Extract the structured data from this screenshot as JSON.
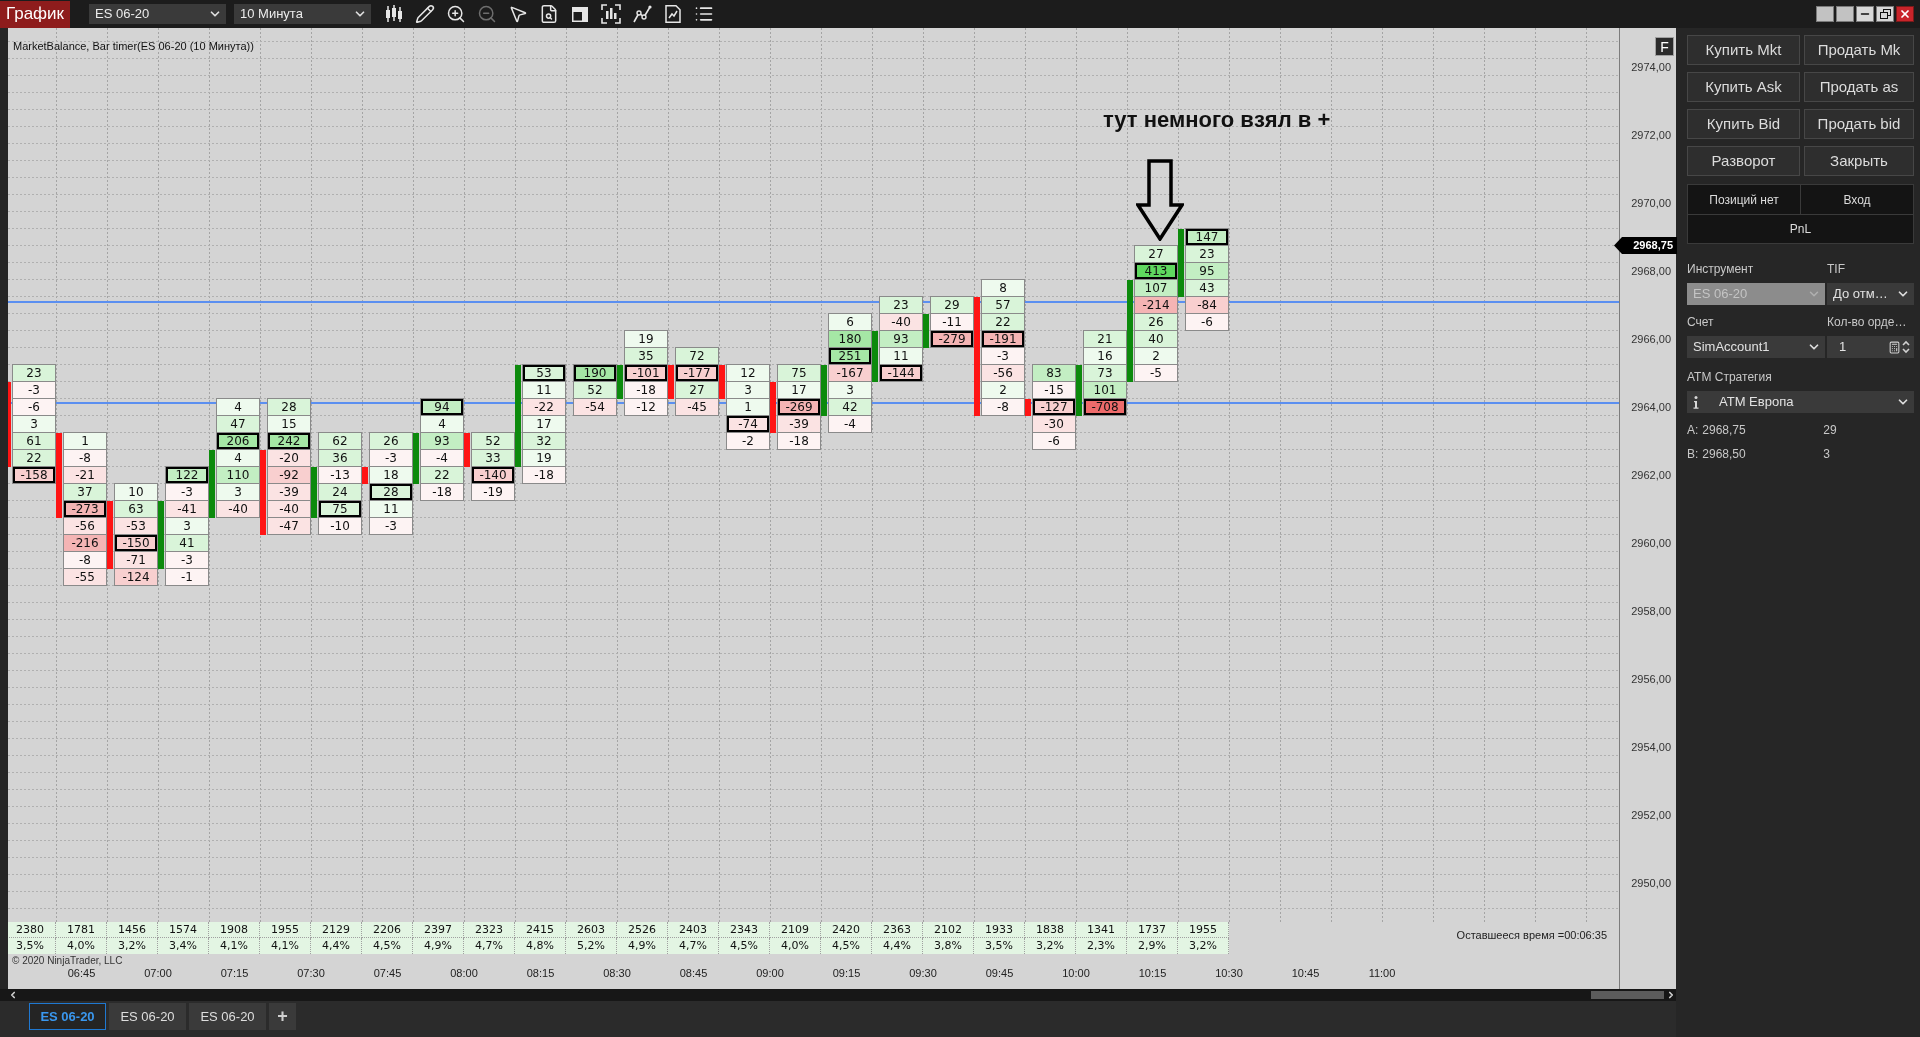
{
  "toolbar": {
    "title": "График",
    "instrument": "ES 06-20",
    "interval": "10 Минута"
  },
  "chart": {
    "title": "MarketBalance, Bar timer(ES 06-20 (10 Минута))",
    "corner_button": "F",
    "annotation": "тут немного взял в +",
    "price_axis": [
      "2974,00",
      "2972,00",
      "2970,00",
      "2968,00",
      "2966,00",
      "2964,00",
      "2962,00",
      "2960,00",
      "2958,00",
      "2956,00",
      "2954,00",
      "2952,00",
      "2950,00"
    ],
    "current_price": "2968,75",
    "bars": [
      {
        "color": "#ff1414",
        "cells": [
          {
            "text": "23",
            "color": "#d9f4d9",
            "boxed": false
          },
          {
            "text": "-3",
            "color": "#fdf3f3",
            "boxed": false
          },
          {
            "text": "-6",
            "color": "#fdf3f3",
            "boxed": false
          },
          {
            "text": "3",
            "color": "#eefaee",
            "boxed": false
          },
          {
            "text": "61",
            "color": "#d9f4d9",
            "boxed": false
          },
          {
            "text": "22",
            "color": "#d9f4d9",
            "boxed": false
          },
          {
            "text": "-158",
            "color": "#f8cfcf",
            "boxed": true
          }
        ]
      },
      {
        "color": "#ff1414",
        "cells": [
          {
            "text": "1",
            "color": "#eefaee",
            "boxed": false
          },
          {
            "text": "-8",
            "color": "#fdf3f3",
            "boxed": false
          },
          {
            "text": "-21",
            "color": "#fbe3e3",
            "boxed": false
          },
          {
            "text": "37",
            "color": "#d9f4d9",
            "boxed": false
          },
          {
            "text": "-273",
            "color": "#f4b4b4",
            "boxed": true
          },
          {
            "text": "-56",
            "color": "#fbe3e3",
            "boxed": false
          },
          {
            "text": "-216",
            "color": "#f4b4b4",
            "boxed": false
          },
          {
            "text": "-8",
            "color": "#fdf3f3",
            "boxed": false
          },
          {
            "text": "-55",
            "color": "#fbe3e3",
            "boxed": false
          }
        ]
      },
      {
        "color": "#ff1414",
        "cells": [
          {
            "text": "10",
            "color": "#eefaee",
            "boxed": false
          },
          {
            "text": "63",
            "color": "#d9f4d9",
            "boxed": false
          },
          {
            "text": "-53",
            "color": "#fbe3e3",
            "boxed": false
          },
          {
            "text": "-150",
            "color": "#f8cfcf",
            "boxed": true
          },
          {
            "text": "-71",
            "color": "#fbe3e3",
            "boxed": false
          },
          {
            "text": "-124",
            "color": "#f8cfcf",
            "boxed": false
          }
        ]
      },
      {
        "color": "#0c8a0c",
        "cells": [
          {
            "text": "122",
            "color": "#c3eec3",
            "boxed": true
          },
          {
            "text": "-3",
            "color": "#fdf3f3",
            "boxed": false
          },
          {
            "text": "-41",
            "color": "#fbe3e3",
            "boxed": false
          },
          {
            "text": "3",
            "color": "#eefaee",
            "boxed": false
          },
          {
            "text": "41",
            "color": "#d9f4d9",
            "boxed": false
          },
          {
            "text": "-3",
            "color": "#fdf3f3",
            "boxed": false
          },
          {
            "text": "-1",
            "color": "#fdf3f3",
            "boxed": false
          }
        ]
      },
      {
        "color": "#0c8a0c",
        "cells": [
          {
            "text": "4",
            "color": "#eefaee",
            "boxed": false
          },
          {
            "text": "47",
            "color": "#d9f4d9",
            "boxed": false
          },
          {
            "text": "206",
            "color": "#a5e7a5",
            "boxed": true
          },
          {
            "text": "4",
            "color": "#eefaee",
            "boxed": false
          },
          {
            "text": "110",
            "color": "#c3eec3",
            "boxed": false
          },
          {
            "text": "3",
            "color": "#eefaee",
            "boxed": false
          },
          {
            "text": "-40",
            "color": "#fbe3e3",
            "boxed": false
          }
        ]
      },
      {
        "color": "#ff1414",
        "cells": [
          {
            "text": "28",
            "color": "#d9f4d9",
            "boxed": false
          },
          {
            "text": "15",
            "color": "#eefaee",
            "boxed": false
          },
          {
            "text": "242",
            "color": "#a5e7a5",
            "boxed": true
          },
          {
            "text": "-20",
            "color": "#fbe3e3",
            "boxed": false
          },
          {
            "text": "-92",
            "color": "#f8cfcf",
            "boxed": false
          },
          {
            "text": "-39",
            "color": "#fbe3e3",
            "boxed": false
          },
          {
            "text": "-40",
            "color": "#fbe3e3",
            "boxed": false
          },
          {
            "text": "-47",
            "color": "#fbe3e3",
            "boxed": false
          }
        ]
      },
      {
        "color": "#0c8a0c",
        "cells": [
          {
            "text": "62",
            "color": "#d9f4d9",
            "boxed": false
          },
          {
            "text": "36",
            "color": "#d9f4d9",
            "boxed": false
          },
          {
            "text": "-13",
            "color": "#fdf3f3",
            "boxed": false
          },
          {
            "text": "24",
            "color": "#d9f4d9",
            "boxed": false
          },
          {
            "text": "75",
            "color": "#d9f4d9",
            "boxed": true
          },
          {
            "text": "-10",
            "color": "#fdf3f3",
            "boxed": false
          }
        ]
      },
      {
        "color": "#ff1414",
        "cells": [
          {
            "text": "26",
            "color": "#d9f4d9",
            "boxed": false
          },
          {
            "text": "-3",
            "color": "#fdf3f3",
            "boxed": false
          },
          {
            "text": "18",
            "color": "#eefaee",
            "boxed": false
          },
          {
            "text": "28",
            "color": "#d9f4d9",
            "boxed": true
          },
          {
            "text": "11",
            "color": "#eefaee",
            "boxed": false
          },
          {
            "text": "-3",
            "color": "#fdf3f3",
            "boxed": false
          }
        ]
      },
      {
        "color": "#0c8a0c",
        "cells": [
          {
            "text": "94",
            "color": "#c3eec3",
            "boxed": true
          },
          {
            "text": "4",
            "color": "#eefaee",
            "boxed": false
          },
          {
            "text": "93",
            "color": "#c3eec3",
            "boxed": false
          },
          {
            "text": "-4",
            "color": "#fdf3f3",
            "boxed": false
          },
          {
            "text": "22",
            "color": "#d9f4d9",
            "boxed": false
          },
          {
            "text": "-18",
            "color": "#fdf3f3",
            "boxed": false
          }
        ]
      },
      {
        "color": "#ff1414",
        "cells": [
          {
            "text": "52",
            "color": "#d9f4d9",
            "boxed": false
          },
          {
            "text": "33",
            "color": "#d9f4d9",
            "boxed": false
          },
          {
            "text": "-140",
            "color": "#f8cfcf",
            "boxed": true
          },
          {
            "text": "-19",
            "color": "#fdf3f3",
            "boxed": false
          }
        ]
      },
      {
        "color": "#0c8a0c",
        "cells": [
          {
            "text": "53",
            "color": "#d9f4d9",
            "boxed": true
          },
          {
            "text": "11",
            "color": "#eefaee",
            "boxed": false
          },
          {
            "text": "-22",
            "color": "#fbe3e3",
            "boxed": false
          },
          {
            "text": "17",
            "color": "#eefaee",
            "boxed": false
          },
          {
            "text": "32",
            "color": "#d9f4d9",
            "boxed": false
          },
          {
            "text": "19",
            "color": "#eefaee",
            "boxed": false
          },
          {
            "text": "-18",
            "color": "#fdf3f3",
            "boxed": false
          }
        ]
      },
      {
        "cells": [
          {
            "text": "190",
            "color": "#a5e7a5",
            "boxed": true
          },
          {
            "text": "52",
            "color": "#d9f4d9",
            "boxed": false
          },
          {
            "text": "-54",
            "color": "#fbe3e3",
            "boxed": false
          }
        ]
      },
      {
        "color": "#0c8a0c",
        "cells": [
          {
            "text": "19",
            "color": "#eefaee",
            "boxed": false
          },
          {
            "text": "35",
            "color": "#d9f4d9",
            "boxed": false
          },
          {
            "text": "-101",
            "color": "#f8cfcf",
            "boxed": true
          },
          {
            "text": "-18",
            "color": "#fdf3f3",
            "boxed": false
          },
          {
            "text": "-12",
            "color": "#fdf3f3",
            "boxed": false
          }
        ]
      },
      {
        "color": "#ff1414",
        "cells": [
          {
            "text": "72",
            "color": "#d9f4d9",
            "boxed": false
          },
          {
            "text": "-177",
            "color": "#f8cfcf",
            "boxed": true
          },
          {
            "text": "27",
            "color": "#d9f4d9",
            "boxed": false
          },
          {
            "text": "-45",
            "color": "#fbe3e3",
            "boxed": false
          }
        ]
      },
      {
        "color": "#ff1414",
        "cells": [
          {
            "text": "12",
            "color": "#eefaee",
            "boxed": false
          },
          {
            "text": "3",
            "color": "#eefaee",
            "boxed": false
          },
          {
            "text": "1",
            "color": "#eefaee",
            "boxed": false
          },
          {
            "text": "-74",
            "color": "#fbe3e3",
            "boxed": true
          },
          {
            "text": "-2",
            "color": "#fdf3f3",
            "boxed": false
          }
        ]
      },
      {
        "color": "#ff1414",
        "cells": [
          {
            "text": "75",
            "color": "#d9f4d9",
            "boxed": false
          },
          {
            "text": "17",
            "color": "#eefaee",
            "boxed": false
          },
          {
            "text": "-269",
            "color": "#f4b4b4",
            "boxed": true
          },
          {
            "text": "-39",
            "color": "#fbe3e3",
            "boxed": false
          },
          {
            "text": "-18",
            "color": "#fdf3f3",
            "boxed": false
          }
        ]
      },
      {
        "color": "#0c8a0c",
        "cells": [
          {
            "text": "6",
            "color": "#eefaee",
            "boxed": false
          },
          {
            "text": "180",
            "color": "#a5e7a5",
            "boxed": false
          },
          {
            "text": "251",
            "color": "#a5e7a5",
            "boxed": true
          },
          {
            "text": "-167",
            "color": "#f8cfcf",
            "boxed": false
          },
          {
            "text": "3",
            "color": "#eefaee",
            "boxed": false
          },
          {
            "text": "42",
            "color": "#d9f4d9",
            "boxed": false
          },
          {
            "text": "-4",
            "color": "#fdf3f3",
            "boxed": false
          }
        ]
      },
      {
        "color": "#0c8a0c",
        "cells": [
          {
            "text": "23",
            "color": "#d9f4d9",
            "boxed": false
          },
          {
            "text": "-40",
            "color": "#fbe3e3",
            "boxed": false
          },
          {
            "text": "93",
            "color": "#c3eec3",
            "boxed": false
          },
          {
            "text": "11",
            "color": "#eefaee",
            "boxed": false
          },
          {
            "text": "-144",
            "color": "#f8cfcf",
            "boxed": true
          }
        ]
      },
      {
        "color": "#0c8a0c",
        "cells": [
          {
            "text": "29",
            "color": "#d9f4d9",
            "boxed": false
          },
          {
            "text": "-11",
            "color": "#fdf3f3",
            "boxed": false
          },
          {
            "text": "-279",
            "color": "#f4b4b4",
            "boxed": true
          }
        ]
      },
      {
        "color": "#ff1414",
        "cells": [
          {
            "text": "8",
            "color": "#eefaee",
            "boxed": false
          },
          {
            "text": "57",
            "color": "#d9f4d9",
            "boxed": false
          },
          {
            "text": "22",
            "color": "#d9f4d9",
            "boxed": false
          },
          {
            "text": "-191",
            "color": "#f4b4b4",
            "boxed": true
          },
          {
            "text": "-3",
            "color": "#fdf3f3",
            "boxed": false
          },
          {
            "text": "-56",
            "color": "#fbe3e3",
            "boxed": false
          },
          {
            "text": "2",
            "color": "#eefaee",
            "boxed": false
          },
          {
            "text": "-8",
            "color": "#fdf3f3",
            "boxed": false
          }
        ]
      },
      {
        "color": "#ff1414",
        "cells": [
          {
            "text": "83",
            "color": "#c3eec3",
            "boxed": false
          },
          {
            "text": "-15",
            "color": "#fdf3f3",
            "boxed": false
          },
          {
            "text": "-127",
            "color": "#f8cfcf",
            "boxed": true
          },
          {
            "text": "-30",
            "color": "#fbe3e3",
            "boxed": false
          },
          {
            "text": "-6",
            "color": "#fdf3f3",
            "boxed": false
          }
        ]
      },
      {
        "color": "#0c8a0c",
        "cells": [
          {
            "text": "21",
            "color": "#d9f4d9",
            "boxed": false
          },
          {
            "text": "16",
            "color": "#eefaee",
            "boxed": false
          },
          {
            "text": "73",
            "color": "#d9f4d9",
            "boxed": false
          },
          {
            "text": "101",
            "color": "#c3eec3",
            "boxed": false
          },
          {
            "text": "-708",
            "color": "#ee6b6b",
            "boxed": true
          }
        ]
      },
      {
        "color": "#0c8a0c",
        "cells": [
          {
            "text": "27",
            "color": "#d9f4d9",
            "boxed": false
          },
          {
            "text": "413",
            "color": "#5fd85f",
            "boxed": true
          },
          {
            "text": "107",
            "color": "#c3eec3",
            "boxed": false
          },
          {
            "text": "-214",
            "color": "#f4b4b4",
            "boxed": false
          },
          {
            "text": "26",
            "color": "#d9f4d9",
            "boxed": false
          },
          {
            "text": "40",
            "color": "#d9f4d9",
            "boxed": false
          },
          {
            "text": "2",
            "color": "#eefaee",
            "boxed": false
          },
          {
            "text": "-5",
            "color": "#fdf3f3",
            "boxed": false
          }
        ]
      },
      {
        "color": "#0c8a0c",
        "cells": [
          {
            "text": "147",
            "color": "#c3eec3",
            "boxed": true
          },
          {
            "text": "23",
            "color": "#d9f4d9",
            "boxed": false
          },
          {
            "text": "95",
            "color": "#c3eec3",
            "boxed": false
          },
          {
            "text": "43",
            "color": "#d9f4d9",
            "boxed": false
          },
          {
            "text": "-84",
            "color": "#f8cfcf",
            "boxed": false
          },
          {
            "text": "-6",
            "color": "#fdf3f3",
            "boxed": false
          }
        ]
      }
    ],
    "volumes": [
      "2380",
      "1781",
      "1456",
      "1574",
      "1908",
      "1955",
      "2129",
      "2206",
      "2397",
      "2323",
      "2415",
      "2603",
      "2526",
      "2403",
      "2343",
      "2109",
      "2420",
      "2363",
      "2102",
      "1933",
      "1838",
      "1341",
      "1737",
      "1955"
    ],
    "percents": [
      "3,5%",
      "4,0%",
      "3,2%",
      "3,4%",
      "4,1%",
      "4,1%",
      "4,4%",
      "4,5%",
      "4,9%",
      "4,7%",
      "4,8%",
      "5,2%",
      "4,9%",
      "4,7%",
      "4,5%",
      "4,0%",
      "4,5%",
      "4,4%",
      "3,8%",
      "3,5%",
      "3,2%",
      "2,3%",
      "2,9%",
      "3,2%"
    ],
    "copyright": "© 2020 NinjaTrader, LLC",
    "remaining_time": "Оставшееся время =00:06:35",
    "time_axis": [
      "06:45",
      "07:00",
      "07:15",
      "07:30",
      "07:45",
      "08:00",
      "08:15",
      "08:30",
      "08:45",
      "09:00",
      "09:15",
      "09:30",
      "09:45",
      "10:00",
      "10:15",
      "10:30",
      "10:45",
      "11:00"
    ]
  },
  "tabs": [
    {
      "label": "ES 06-20",
      "selected": true
    },
    {
      "label": "ES 06-20",
      "selected": false
    },
    {
      "label": "ES 06-20",
      "selected": false
    }
  ],
  "add_tab": "+",
  "order_panel": {
    "buttons": [
      "Купить Mkt",
      "Продать Mk",
      "Купить Ask",
      "Продать as",
      "Купить Bid",
      "Продать bid",
      "Разворот",
      "Закрыть"
    ],
    "position": {
      "status": "Позиций нет",
      "entry": "Вход",
      "pnl": "PnL"
    },
    "instrument": {
      "label": "Инструмент",
      "value": "ES 06-20",
      "disabled": true
    },
    "tif": {
      "label": "TIF",
      "value": "До отм…"
    },
    "account": {
      "label": "Счет",
      "value": "SimAccount1"
    },
    "quantity": {
      "label": "Кол-во орде…",
      "value": "1"
    },
    "atm": {
      "label": "ATM Стратегия",
      "value": "ATM Европа"
    },
    "quotes": [
      {
        "label": "A:",
        "price": "2968,75",
        "size": "29"
      },
      {
        "label": "B:",
        "price": "2968,50",
        "size": "3"
      }
    ]
  }
}
